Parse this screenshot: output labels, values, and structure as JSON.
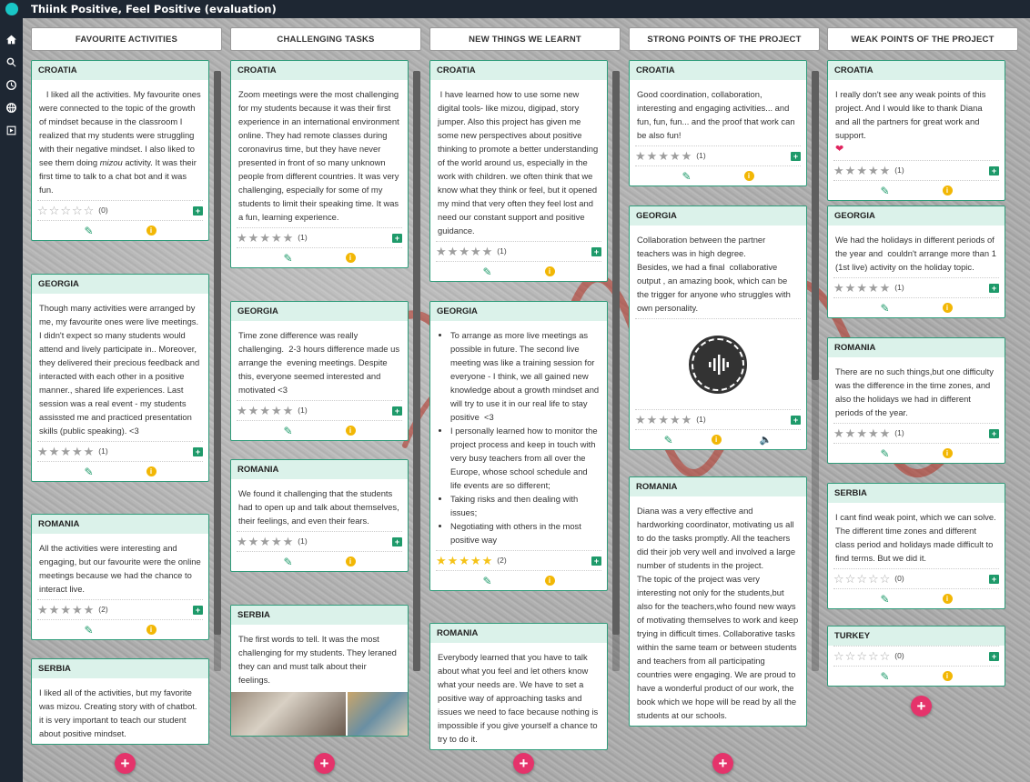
{
  "app": {
    "title": "Thiink Positive, Feel Positive (evaluation)"
  },
  "nav": [
    {
      "icon": "home-icon"
    },
    {
      "icon": "search-icon"
    },
    {
      "icon": "clock-icon"
    },
    {
      "icon": "globe-icon"
    },
    {
      "icon": "slideshow-icon"
    }
  ],
  "colors": {
    "accent": "#2f9c7a",
    "header_bg": "#dbf2ea",
    "add": "#e5336b",
    "topbar": "#1e2733"
  },
  "columns": [
    {
      "title": "FAVOURITE ACTIVITIES",
      "posts": [
        {
          "author": "CROATIA",
          "html": "&nbsp;&nbsp;&nbsp;I liked all the activities. My favourite ones were connected to the topic of the growth of mindset because in the classroom I realized that my students were struggling with their negative mindset. I also liked to see them doing <i>mizou</i> activity. It was their first time to talk to a chat bot and it was fun.",
          "stars": 0,
          "count": "(0)",
          "star_style": "empty"
        },
        {
          "author": "GEORGIA",
          "html": "Though many activities were arranged by me, my favourite ones were live meetings. I didn't expect so many students would attend and lively participate in.. Moreover, they delivered their precious feedback and interacted with each other in a positive manner., shared life experiences. Last session was a real event - my students assissted me and practiced presentation skills (public speaking). &lt;3",
          "stars": 5,
          "count": "(1)",
          "star_style": "grey"
        },
        {
          "author": "ROMANIA",
          "html": "All the activities were interesting and engaging, but our favourite were the online meetings because we had the chance to interact live.",
          "stars": 5,
          "count": "(2)",
          "star_style": "grey"
        },
        {
          "author": "SERBIA",
          "html": "I liked all of the activities, but my favorite was mizou. Creating story with of chatbot. it is very important to teach our student about positive mindset.",
          "stars": 0,
          "count": "",
          "star_style": "none"
        }
      ]
    },
    {
      "title": "CHALLENGING TASKS",
      "posts": [
        {
          "author": "CROATIA",
          "html": "Zoom meetings were the most challenging for my students because it was their first experience in an international environment online. They had remote classes during coronavirus time, but they have never presented in front of so many unknown people from different countries. It was very challenging, especially for some of my students to limit their speaking time. It was a fun, learning experience.",
          "stars": 5,
          "count": "(1)",
          "star_style": "grey"
        },
        {
          "author": "GEORGIA",
          "html": "Time zone difference was really challenging.&nbsp; 2-3 hours difference made us arrange the&nbsp; evening meetings. Despite this, everyone seemed interested and motivated &lt;3",
          "stars": 5,
          "count": "(1)",
          "star_style": "grey"
        },
        {
          "author": "ROMANIA",
          "html": "We found it challenging that the students had to open up and talk about themselves, their feelings, and even their fears.",
          "stars": 5,
          "count": "(1)",
          "star_style": "grey"
        },
        {
          "author": "SERBIA",
          "html": "The first words to tell. It was the most challenging for my students. They leraned&nbsp; they can and must talk about their feelings.",
          "stars": 0,
          "count": "",
          "star_style": "none"
        }
      ]
    },
    {
      "title": "NEW THINGS WE LEARNT",
      "posts": [
        {
          "author": "CROATIA",
          "html": "&nbsp;I have learned how to use some new digital tools- like mizou, digipad, story jumper. Also this project has given me some new perspectives about positive thinking to promote a better understanding of the world around us, especially in the work with children. we often think that we know what they think or feel, but it opened my mind that very often they feel lost and need our constant support and positive guidance.",
          "stars": 5,
          "count": "(1)",
          "star_style": "grey"
        },
        {
          "author": "GEORGIA",
          "html": "<ul><li>To arrange as more live meetings as possible in future. The second live meeting was like a training session for everyone - I think, we all gained new knowledge about a growth mindset and will try to use it in our real life to stay positive&nbsp; &lt;3</li><li>I personally learned how to monitor the project process and keep in touch with very busy teachers from all over the Europe, whose school schedule and life events are so different;</li><li>Taking risks and then dealing with issues;</li><li>Negotiating with others in the most positive way</li></ul>",
          "stars": 5,
          "count": "(2)",
          "star_style": "gold"
        },
        {
          "author": "ROMANIA",
          "html": "Everybody learned that you have to talk about what you feel and let others know what your needs are. We have to set a positive way of approaching tasks and issues we need to face because nothing is impossible if you give yourself a chance to try to do it.",
          "stars": 0,
          "count": "",
          "star_style": "none"
        }
      ]
    },
    {
      "title": "STRONG POINTS OF THE PROJECT",
      "posts": [
        {
          "author": "CROATIA",
          "html": "Good coordination, collaboration, interesting and engaging activities... and fun, fun, fun... and the proof that work can be also fun!",
          "stars": 5,
          "count": "(1)",
          "star_style": "grey"
        },
        {
          "author": "GEORGIA",
          "html": "Collaboration between the partner teachers was in high degree.<br>Besides, we had a final&nbsp; collaborative output , an amazing book, which can be the trigger for anyone who struggles with own personality.",
          "stars": 5,
          "count": "(1)",
          "star_style": "grey"
        },
        {
          "author": "ROMANIA",
          "html": "Diana was a very effective and hardworking coordinator, motivating us all to do the tasks promptly. All the teachers did their job very well and involved a large number of students in the project.<br>The topic of the project was very interesting not only for the students,but also for the teachers,who found new ways of motivating themselves to work and keep trying in difficult times. Collaborative tasks within the same team or between students and teachers from all participating countries were engaging. We are proud to have a wonderful product of our work, the book which we hope will be read by all the students at our schools.",
          "stars": 0,
          "count": "",
          "star_style": "none"
        }
      ]
    },
    {
      "title": "WEAK POINTS OF THE PROJECT",
      "posts": [
        {
          "author": "CROATIA",
          "html": "I really don't see any weak points of this project. And I would like to thank Diana and all the partners for great work and support.<br><span style='color:#e0245e;font-size:11px'>&#10084;</span>",
          "stars": 5,
          "count": "(1)",
          "star_style": "grey"
        },
        {
          "author": "GEORGIA",
          "html": "We had the holidays in different periods of the year and&nbsp; couldn't arrange more than 1 (1st live) activity on the holiday topic.",
          "stars": 5,
          "count": "(1)",
          "star_style": "grey"
        },
        {
          "author": "ROMANIA",
          "html": "There are no such things,but one difficulty was the difference in the time zones, and also the holidays we had in different periods of the year.",
          "stars": 5,
          "count": "(1)",
          "star_style": "grey"
        },
        {
          "author": "SERBIA",
          "html": "I cant find weak point, which we can solve. The different time zones and different class period and holidays made difficult to find terms. But we did it.",
          "stars": 0,
          "count": "(0)",
          "star_style": "empty"
        },
        {
          "author": "TURKEY",
          "html": "",
          "stars": 0,
          "count": "(0)",
          "star_style": "empty"
        }
      ]
    }
  ]
}
